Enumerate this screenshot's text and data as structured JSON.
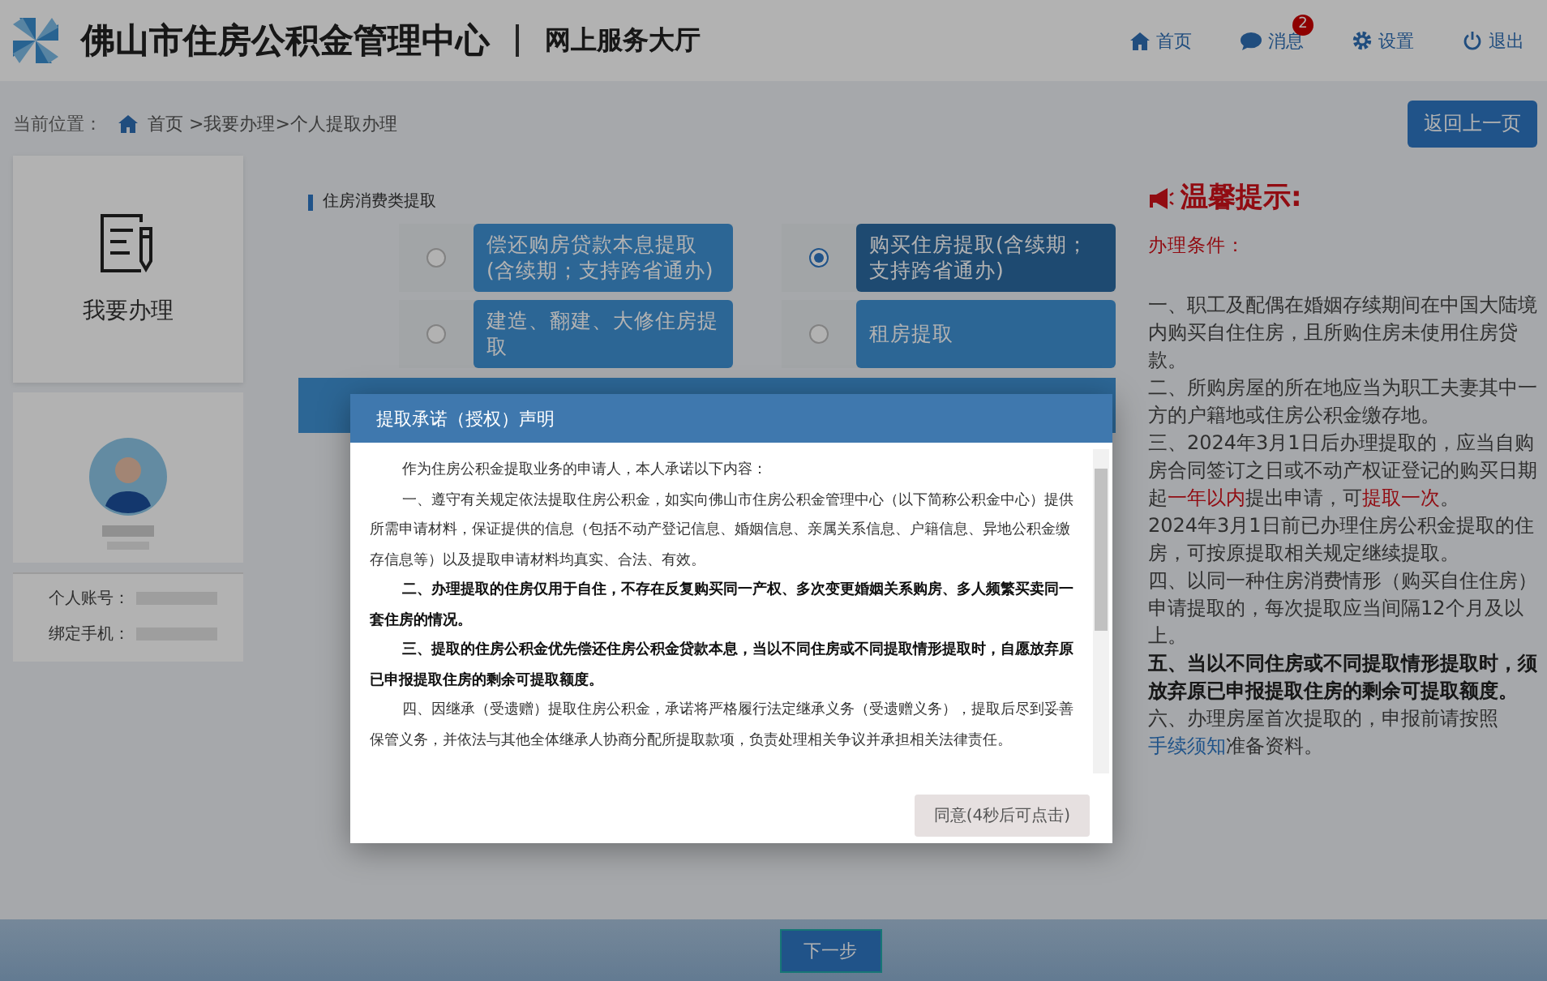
{
  "header": {
    "title": "佛山市住房公积金管理中心",
    "subtitle": "网上服务大厅",
    "nav": [
      {
        "kind": "home",
        "label": "首页"
      },
      {
        "kind": "message",
        "label": "消息",
        "badge": "2"
      },
      {
        "kind": "settings",
        "label": "设置"
      },
      {
        "kind": "logout",
        "label": "退出"
      }
    ]
  },
  "breadcrumb": {
    "label": "当前位置：",
    "path": "首页 >我要办理>个人提取办理"
  },
  "back_button": "返回上一页",
  "sidebar": {
    "action": "我要办理",
    "fields": [
      {
        "label": "个人账号："
      },
      {
        "label": "绑定手机："
      }
    ]
  },
  "section": {
    "title": "住房消费类提取",
    "options": [
      {
        "label": "偿还购房贷款本息提取(含续期；支持跨省通办)",
        "selected": false
      },
      {
        "label": "购买住房提取(含续期；支持跨省通办)",
        "selected": true
      },
      {
        "label": "建造、翻建、大修住房提取",
        "selected": false
      },
      {
        "label": "租房提取",
        "selected": false
      }
    ]
  },
  "tips": {
    "title": "温馨提示:",
    "subtitle": "办理条件：",
    "items": [
      {
        "kind": "plain",
        "text": "一、职工及配偶在婚姻存续期间在中国大陆境内购买自住住房，且所购住房未使用住房贷款。"
      },
      {
        "kind": "plain",
        "text": "二、所购房屋的所在地应当为职工夫妻其中一方的户籍地或住房公积金缴存地。"
      },
      {
        "kind": "highlight",
        "parts": [
          {
            "text": "三、2024年3月1日后办理提取的，应当自购房合同签订之日或不动产权证登记的购买日期起",
            "highlight": false
          },
          {
            "text": "一年以内",
            "highlight": true
          },
          {
            "text": "提出申请，可",
            "highlight": false
          },
          {
            "text": "提取一次",
            "highlight": true
          },
          {
            "text": "。",
            "highlight": false
          }
        ]
      },
      {
        "kind": "plain",
        "text": "2024年3月1日前已办理住房公积金提取的住房，可按原提取相关规定继续提取。"
      },
      {
        "kind": "plain",
        "text": "四、以同一种住房消费情形（购买自住住房）申请提取的，每次提取应当间隔12个月及以上。"
      },
      {
        "kind": "bold",
        "text": "五、当以不同住房或不同提取情形提取时，须放弃原已申报提取住房的剩余可提取额度。"
      },
      {
        "kind": "link",
        "text": "六、办理房屋首次提取的，申报前请按照",
        "link": "手续须知",
        "after": "准备资料。"
      }
    ]
  },
  "dialog": {
    "title": "提取承诺（授权）声明",
    "paragraphs": [
      {
        "text": "作为住房公积金提取业务的申请人，本人承诺以下内容：",
        "bold": false
      },
      {
        "text": "一、遵守有关规定依法提取住房公积金，如实向佛山市住房公积金管理中心（以下简称公积金中心）提供所需申请材料，保证提供的信息（包括不动产登记信息、婚姻信息、亲属关系信息、户籍信息、异地公积金缴存信息等）以及提取申请材料均真实、合法、有效。",
        "bold": false
      },
      {
        "text": "二、办理提取的住房仅用于自住，不存在反复购买同一产权、多次变更婚姻关系购房、多人频繁买卖同一套住房的情况。",
        "bold": true
      },
      {
        "text": "三、提取的住房公积金优先偿还住房公积金贷款本息，当以不同住房或不同提取情形提取时，自愿放弃原已申报提取住房的剩余可提取额度。",
        "bold": true
      },
      {
        "text": "四、因继承（受遗赠）提取住房公积金，承诺将严格履行法定继承义务（受遗赠义务），提取后尽到妥善保管义务，并依法与其他全体继承人协商分配所提取款项，负责处理相关争议并承担相关法律责任。",
        "bold": false
      }
    ],
    "confirm": {
      "label": "同意(4秒后可点击)",
      "disabled": true
    }
  },
  "next_button": "下一步"
}
